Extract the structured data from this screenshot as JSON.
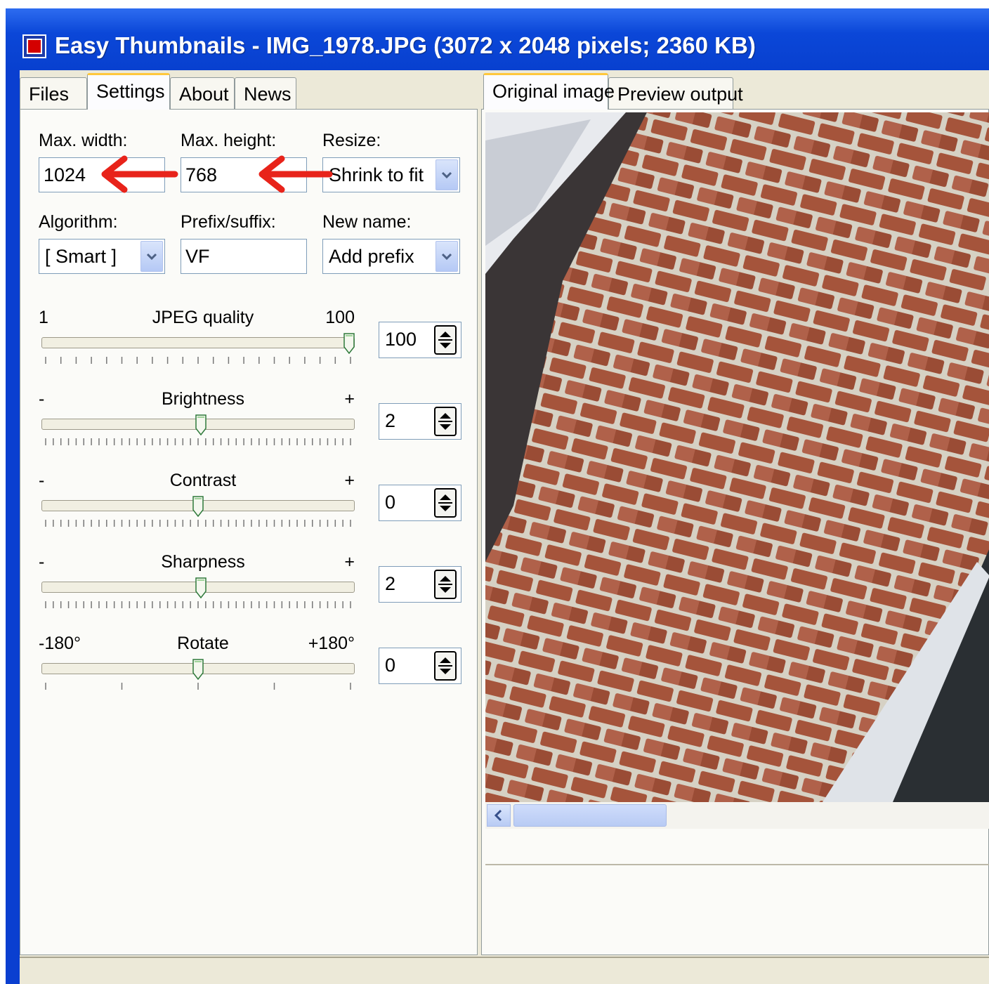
{
  "window": {
    "title": "Easy Thumbnails - IMG_1978.JPG  (3072 x 2048 pixels;  2360 KB)"
  },
  "left_tabs": [
    {
      "label": "Files",
      "active": false
    },
    {
      "label": "Settings",
      "active": true
    },
    {
      "label": "About",
      "active": false
    },
    {
      "label": "News",
      "active": false
    }
  ],
  "right_tabs": [
    {
      "label": "Original image",
      "active": true
    },
    {
      "label": "Preview output",
      "active": false
    }
  ],
  "settings": {
    "max_width": {
      "label": "Max. width:",
      "value": "1024"
    },
    "max_height": {
      "label": "Max. height:",
      "value": "768"
    },
    "resize": {
      "label": "Resize:",
      "value": "Shrink to fit"
    },
    "algorithm": {
      "label": "Algorithm:",
      "value": "[ Smart ]"
    },
    "prefix_suffix": {
      "label": "Prefix/suffix:",
      "value": "VF"
    },
    "new_name": {
      "label": "New name:",
      "value": "Add prefix"
    }
  },
  "sliders": {
    "jpeg": {
      "label": "JPEG quality",
      "min_label": "1",
      "max_label": "100",
      "value": "100",
      "position": 1.0
    },
    "brightness": {
      "label": "Brightness",
      "min_label": "-",
      "max_label": "+",
      "value": "2",
      "position": 0.51
    },
    "contrast": {
      "label": "Contrast",
      "min_label": "-",
      "max_label": "+",
      "value": "0",
      "position": 0.5
    },
    "sharpness": {
      "label": "Sharpness",
      "min_label": "-",
      "max_label": "+",
      "value": "2",
      "position": 0.51
    },
    "rotate": {
      "label": "Rotate",
      "min_label": "-180°",
      "max_label": "+180°",
      "value": "0",
      "position": 0.5
    }
  },
  "annotations": {
    "arrow_color": "#e8231a"
  },
  "colors": {
    "titlebar": "#0b47d8",
    "tab_highlight": "#ffc83c",
    "brick": "#a3543a",
    "mortar": "#d8d4c8"
  },
  "icons": [
    "app-icon",
    "chevron-down-icon",
    "spin-updown-icon",
    "scroll-left-icon"
  ]
}
